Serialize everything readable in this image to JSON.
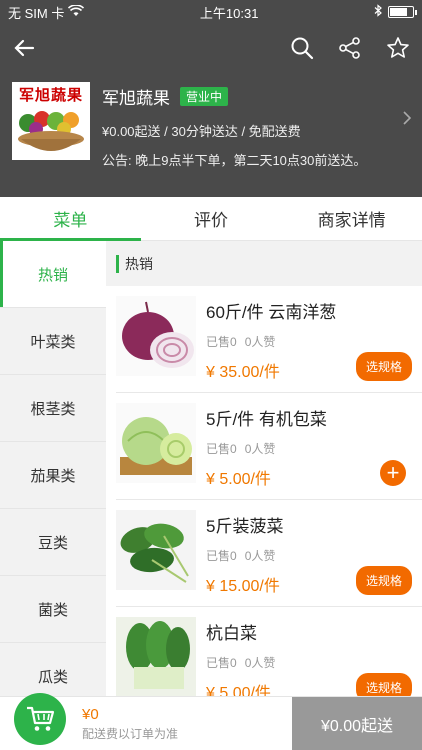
{
  "status_bar": {
    "carrier": "无 SIM 卡",
    "time": "上午10:31"
  },
  "store": {
    "logo_text": "军旭蔬果",
    "name": "军旭蔬果",
    "status_badge": "营业中",
    "meta": "¥0.00起送 / 30分钟送达 / 免配送费",
    "notice": "公告: 晚上9点半下单，第二天10点30前送达。"
  },
  "tabs": [
    {
      "label": "菜单",
      "active": true
    },
    {
      "label": "评价",
      "active": false
    },
    {
      "label": "商家详情",
      "active": false
    }
  ],
  "categories": [
    "热销",
    "叶菜类",
    "根茎类",
    "茄果类",
    "豆类",
    "菌类",
    "瓜类"
  ],
  "section_title": "热销",
  "products": [
    {
      "name": "60斤/件  云南洋葱",
      "sold": "已售0",
      "likes": "0人赞",
      "price": "¥ 35.00/件",
      "action": "选规格"
    },
    {
      "name": "5斤/件 有机包菜",
      "sold": "已售0",
      "likes": "0人赞",
      "price": "¥ 5.00/件",
      "action": "+"
    },
    {
      "name": "5斤装菠菜",
      "sold": "已售0",
      "likes": "0人赞",
      "price": "¥ 15.00/件",
      "action": "选规格"
    },
    {
      "name": "杭白菜",
      "sold": "已售0",
      "likes": "0人赞",
      "price": "¥ 5.00/件",
      "action": "选规格"
    }
  ],
  "cart": {
    "total": "¥0",
    "note": "配送费以订单为准",
    "submit_label": "¥0.00起送"
  },
  "colors": {
    "accent_green": "#2db34a",
    "price_orange": "#f07800",
    "header_bg": "#4a4a4a"
  }
}
